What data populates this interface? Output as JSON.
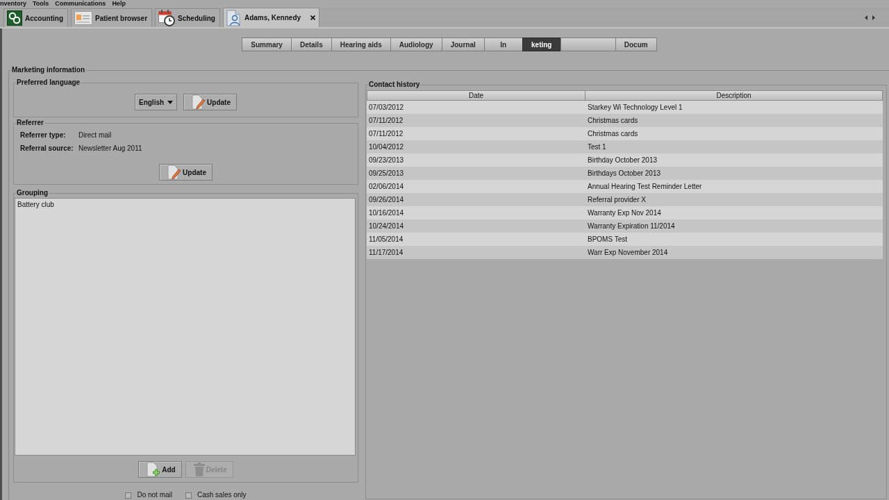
{
  "menu_bar": [
    "nventory",
    "Tools",
    "Communications",
    "Help"
  ],
  "module_tabs": [
    {
      "kind": "accounting",
      "label": "Accounting",
      "selected": false,
      "closable": false
    },
    {
      "kind": "browser",
      "label": "Patient browser",
      "selected": false,
      "closable": false
    },
    {
      "kind": "scheduling",
      "label": "Scheduling",
      "selected": false,
      "closable": false
    },
    {
      "kind": "patient",
      "label": "Adams, Kennedy",
      "selected": true,
      "closable": true
    }
  ],
  "section_tabs": [
    {
      "label": "Summary",
      "selected": false
    },
    {
      "label": "Details",
      "selected": false
    },
    {
      "label": "Hearing aids",
      "selected": false
    },
    {
      "label": "Audiology",
      "selected": false
    },
    {
      "label": "Journal",
      "selected": false
    },
    {
      "label": "In",
      "selected": false
    },
    {
      "label": "keting",
      "selected": true
    },
    {
      "selected": false
    },
    {
      "label": "Docum",
      "selected": false
    }
  ],
  "marketing_information": {
    "title": "Marketing information",
    "preferred_language": {
      "title": "Preferred language",
      "language_dropdown": {
        "value": "English"
      },
      "update_button": {
        "label": "Update"
      }
    },
    "referrer": {
      "title": "Referrer",
      "fields": [
        {
          "label": "Referrer type:",
          "value": "Direct mail"
        },
        {
          "label": "Referral source:",
          "value": "Newsletter Aug 2011"
        }
      ],
      "update_button": {
        "label": "Update"
      }
    },
    "grouping": {
      "title": "Grouping",
      "items": [
        {
          "label": "Battery club",
          "selected": false
        }
      ],
      "buttons": [
        {
          "kind": "add",
          "label": "Add",
          "disabled": false
        },
        {
          "kind": "delete",
          "label": "Delete",
          "disabled": true
        }
      ]
    },
    "checkboxes": [
      {
        "label": "Do not mail",
        "checked": false
      },
      {
        "label": "Cash sales only",
        "checked": false
      }
    ],
    "contact_history": {
      "title": "Contact history",
      "columns": [
        "Date",
        "Description"
      ],
      "rows": [
        {
          "cells": [
            "07/03/2012",
            "Starkey Wi Technology Level 1"
          ],
          "selected": false
        },
        {
          "cells": [
            "07/11/2012",
            "Christmas cards"
          ],
          "selected": false
        },
        {
          "cells": [
            "07/11/2012",
            "Christmas cards"
          ],
          "selected": false
        },
        {
          "cells": [
            "10/04/2012",
            "Test 1"
          ],
          "selected": false
        },
        {
          "cells": [
            "09/23/2013",
            "Birthday October 2013"
          ],
          "selected": false
        },
        {
          "cells": [
            "09/25/2013",
            "Birthdays October 2013"
          ],
          "selected": false
        },
        {
          "cells": [
            "02/06/2014",
            "Annual Hearing Test Reminder Letter"
          ],
          "selected": false
        },
        {
          "cells": [
            "09/26/2014",
            "Referral provider X"
          ],
          "selected": false
        },
        {
          "cells": [
            "10/16/2014",
            "Warranty Exp Nov 2014"
          ],
          "selected": false
        },
        {
          "cells": [
            "10/24/2014",
            "Warranty Expiration 11/2014"
          ],
          "selected": false
        },
        {
          "cells": [
            "11/05/2014",
            "BPOMS Test"
          ],
          "selected": false
        },
        {
          "cells": [
            "11/17/2014",
            "Warr Exp November 2014"
          ],
          "selected": false
        }
      ]
    }
  }
}
